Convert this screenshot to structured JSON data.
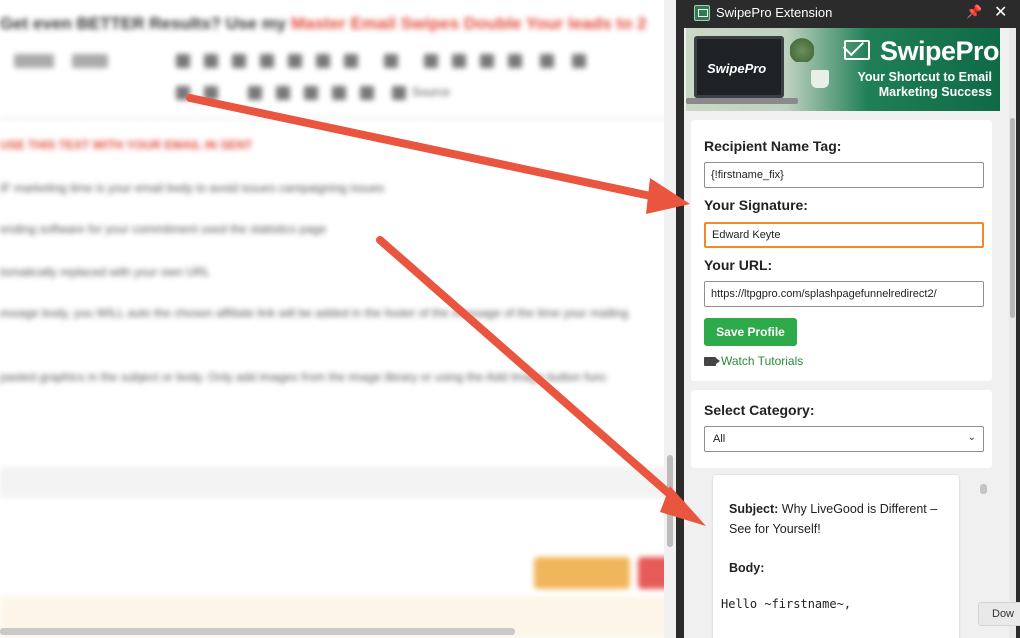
{
  "background_editor": {
    "headline_prefix": "Get even BETTER Results? ",
    "headline_mid": "Use my ",
    "headline_red1": "Master Email Swipes",
    "headline_red2": " Double Your leads to 2",
    "lines": [
      "USE THIS TEXT WITH YOUR EMAIL IN SENT",
      "IF marketing time is your email body to avoid issues campaigning issues",
      "ending software for your commitment used the statistics page",
      "tomatically replaced with your own URL",
      "essage body, you WILL auto the chosen affiliate link will be added in the footer of the message of the time your mailing",
      "pasted graphics in the subject or body. Only add images from the image library or using the Add Image button func"
    ],
    "toolbar_label": "Source"
  },
  "extension": {
    "title": "SwipePro Extension",
    "icons": {
      "app": "swipepro-app-icon",
      "pin": "pin-icon",
      "close": "close-icon"
    },
    "close_glyph": "✕",
    "pin_glyph": "📌",
    "banner": {
      "laptop_text": "SwipePro",
      "brand": "SwipePro",
      "tagline_line1": "Your Shortcut to Email",
      "tagline_line2": "Marketing Success"
    },
    "profile": {
      "recipient_label": "Recipient Name Tag:",
      "recipient_value": "{!firstname_fix}",
      "signature_label": "Your Signature:",
      "signature_value": "Edward Keyte",
      "url_label": "Your URL:",
      "url_value": "https://ltpgpro.com/splashpagefunnelredirect2/",
      "save_label": "Save Profile",
      "tutorials_label": "Watch Tutorials"
    },
    "category": {
      "label": "Select Category:",
      "selected": "All"
    },
    "swipe": {
      "subject_label": "Subject:",
      "subject_text": " Why LiveGood is Different – See for Yourself!",
      "body_label": "Body:",
      "body_text": "Hello ~firstname~,"
    },
    "download_label": "Dow"
  },
  "colors": {
    "accent_green": "#2faa4a",
    "link_green": "#2c8a3c",
    "focus_orange": "#f08a2b",
    "arrow_red": "#e9553f",
    "titlebar": "#2b2b2b"
  }
}
